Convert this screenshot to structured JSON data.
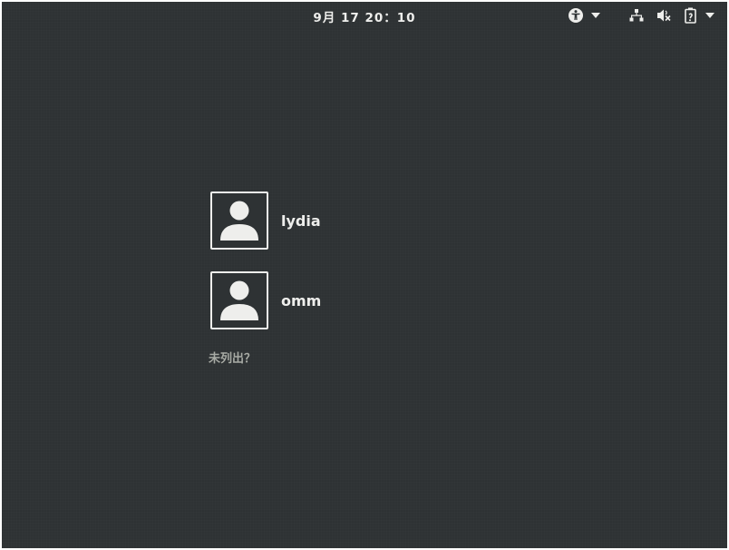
{
  "topbar": {
    "clock": "9月 17 20：10",
    "icons": {
      "accessibility": "accessibility-icon",
      "accessibility_menu": "chevron-down-icon",
      "network": "network-wired-icon",
      "volume": "volume-muted-icon",
      "battery": "battery-icon",
      "system_menu": "chevron-down-icon"
    }
  },
  "users": [
    {
      "name": "lydia",
      "avatar": "user-avatar-icon"
    },
    {
      "name": "omm",
      "avatar": "user-avatar-icon"
    }
  ],
  "not_listed_label": "未列出？",
  "colors": {
    "background": "#2e3234",
    "text": "#eeeeec",
    "muted_text": "#a8aba5"
  }
}
